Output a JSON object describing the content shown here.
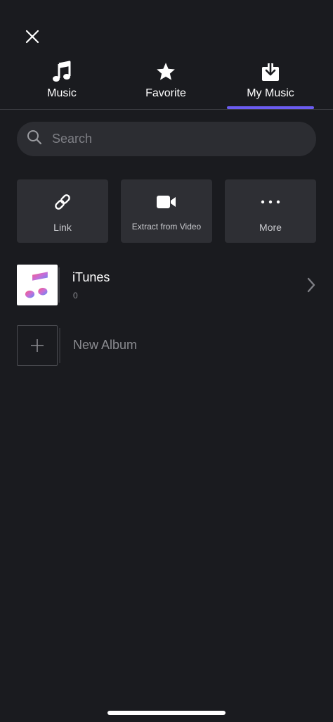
{
  "header": {
    "close_icon": "close-icon"
  },
  "tabs": [
    {
      "label": "Music",
      "icon": "music-note-icon",
      "selected": false
    },
    {
      "label": "Favorite",
      "icon": "star-icon",
      "selected": false
    },
    {
      "label": "My Music",
      "icon": "download-box-icon",
      "selected": true
    }
  ],
  "colors": {
    "background": "#1a1b1f",
    "accent": "#6b5cf0",
    "card": "#2e2f34",
    "search_bg": "#2c2d32"
  },
  "search": {
    "placeholder": "Search",
    "value": ""
  },
  "actions": [
    {
      "label": "Link",
      "icon": "link-icon"
    },
    {
      "label": "Extract from Video",
      "icon": "video-camera-icon"
    },
    {
      "label": "More",
      "icon": "more-dots-icon"
    }
  ],
  "library": {
    "itunes": {
      "title": "iTunes",
      "count": "0",
      "icon": "itunes-music-icon"
    },
    "new_album": {
      "label": "New Album",
      "icon": "plus-icon"
    }
  }
}
